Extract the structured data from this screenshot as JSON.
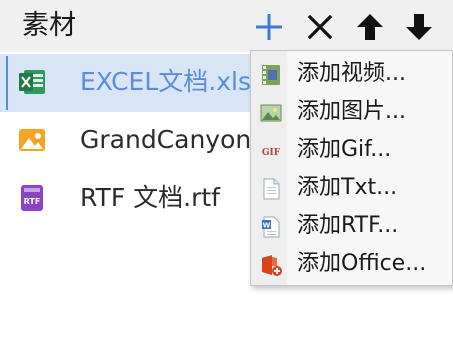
{
  "header": {
    "title": "素材",
    "buttons": [
      {
        "name": "add",
        "icon": "plus-icon",
        "color": "#3a7bd5"
      },
      {
        "name": "remove",
        "icon": "close-icon",
        "color": "#111111"
      },
      {
        "name": "move-up",
        "icon": "arrow-up-icon",
        "color": "#111111"
      },
      {
        "name": "move-down",
        "icon": "arrow-down-icon",
        "color": "#111111"
      }
    ]
  },
  "files": [
    {
      "label": "EXCEL文档.xlsx",
      "icon": "excel-file-icon",
      "selected": true
    },
    {
      "label": "GrandCanyon",
      "icon": "image-file-icon",
      "selected": false
    },
    {
      "label": "RTF 文档.rtf",
      "icon": "rtf-file-icon",
      "selected": false
    }
  ],
  "add_menu": {
    "items": [
      {
        "label": "添加视频...",
        "icon": "video-icon"
      },
      {
        "label": "添加图片...",
        "icon": "picture-icon"
      },
      {
        "label": "添加Gif...",
        "icon": "gif-icon"
      },
      {
        "label": "添加Txt...",
        "icon": "txt-document-icon"
      },
      {
        "label": "添加RTF...",
        "icon": "rtf-document-icon"
      },
      {
        "label": "添加Office...",
        "icon": "office-icon"
      }
    ]
  },
  "colors": {
    "accent": "#3a7bd5",
    "selection_bg": "#d7e5f7",
    "selection_text": "#5b8ed6",
    "header_bg": "#f0f0f0",
    "excel_green": "#1f7a45",
    "rtf_purple": "#8a44c8",
    "image_orange": "#f4a521",
    "office_red": "#d9421c"
  }
}
